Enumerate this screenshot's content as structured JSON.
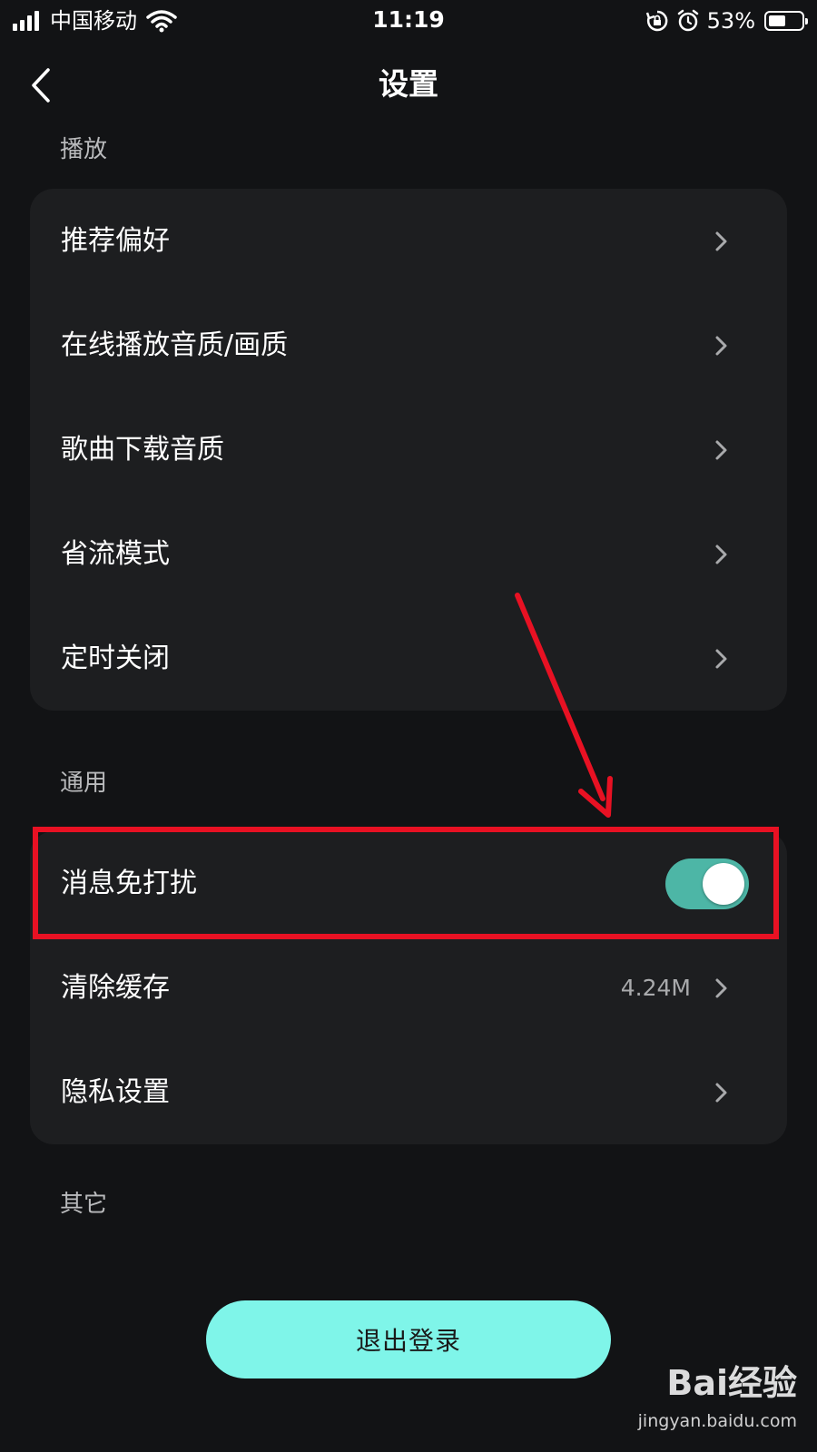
{
  "status_bar": {
    "carrier": "中国移动",
    "time": "11:19",
    "battery_percent": "53%",
    "battery_level": 0.53,
    "icons": [
      "signal-icon",
      "wifi-icon",
      "rotation-lock-icon",
      "alarm-icon",
      "battery-icon"
    ]
  },
  "nav": {
    "title": "设置",
    "back_icon": "chevron-left-icon"
  },
  "sections": {
    "playback": {
      "title": "播放",
      "items": [
        {
          "label": "推荐偏好"
        },
        {
          "label": "在线播放音质/画质"
        },
        {
          "label": "歌曲下载音质"
        },
        {
          "label": "省流模式"
        },
        {
          "label": "定时关闭"
        }
      ]
    },
    "general": {
      "title": "通用",
      "items": [
        {
          "label": "消息免打扰",
          "toggle_on": true
        },
        {
          "label": "清除缓存",
          "value": "4.24M"
        },
        {
          "label": "隐私设置"
        }
      ]
    },
    "other": {
      "title": "其它"
    }
  },
  "logout": {
    "label": "退出登录"
  },
  "watermark": {
    "logo": "Bai经验",
    "url": "jingyan.baidu.com"
  },
  "colors": {
    "background": "#121315",
    "card": "#1d1e20",
    "toggle_on": "#4db6a6",
    "logout_button": "#7ff5e9",
    "annotation": "#e81123"
  }
}
